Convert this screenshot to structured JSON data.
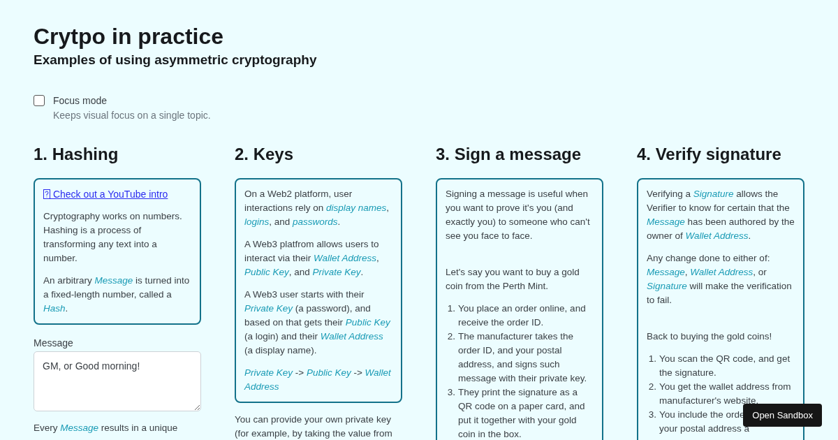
{
  "header": {
    "title": "Crytpo in practice",
    "subtitle": "Examples of using asymmetric cryptography"
  },
  "focus_mode": {
    "label": "Focus mode",
    "description": "Keeps visual focus on a single topic.",
    "checked": false
  },
  "sections": [
    {
      "heading": "1. Hashing",
      "card": [
        {
          "kind": "link",
          "text": "Check out a YouTube intro"
        },
        {
          "kind": "paragraph",
          "text": "Cryptography works on numbers. Hashing is a process of transforming any text into a number."
        },
        {
          "kind": "paragraph",
          "text": "An arbitrary *Message* is turned into a fixed-length number, called a *Hash*."
        }
      ],
      "after": [
        {
          "kind": "field",
          "label": "Message",
          "value": "GM, or Good morning!"
        },
        {
          "kind": "paragraph",
          "text": "Every *Message* results in a unique"
        }
      ]
    },
    {
      "heading": "2. Keys",
      "card": [
        {
          "kind": "paragraph",
          "text": "On a Web2 platform, user interactions rely on *display names*, *logins*, and *passwords*."
        },
        {
          "kind": "paragraph",
          "text": "A Web3 platfrom allows users to interact via their *Wallet Address*, *Public Key*, and *Private Key*."
        },
        {
          "kind": "paragraph",
          "text": "A Web3 user starts with their *Private Key* (a password), and based on that gets their *Public Key* (a login) and their *Wallet Address* (a display name)."
        },
        {
          "kind": "paragraph",
          "text": "*Private Key* -> *Public Key* -> *Wallet Address*"
        }
      ],
      "after": [
        {
          "kind": "paragraph",
          "text": "You can provide your own private key (for example, by taking the value from"
        }
      ]
    },
    {
      "heading": "3. Sign a message",
      "card": [
        {
          "kind": "paragraph",
          "text": "Signing a message is useful when you want to prove it's you (and exactly you) to someone who can't see you face to face."
        },
        {
          "kind": "spacer"
        },
        {
          "kind": "paragraph",
          "text": "Let's say you want to buy a gold coin from the Perth Mint."
        },
        {
          "kind": "list",
          "items": [
            {
              "marker": "1.",
              "lines": [
                "You place an order online, and receive the order ID."
              ]
            },
            {
              "marker": "2.",
              "lines": [
                "The manufacturer takes the order ID, and your postal address, and signs such message with their private key."
              ]
            },
            {
              "marker": "3.",
              "lines": [
                "They print the signature as a QR code on a paper card, and put it together with your gold coin in the box."
              ]
            }
          ]
        }
      ]
    },
    {
      "heading": "4. Verify signature",
      "card": [
        {
          "kind": "paragraph",
          "text": "Verifying a *Signature* allows the Verifier to know for certain that the *Message* has been authored by the owner of *Wallet Address*."
        },
        {
          "kind": "paragraph",
          "text": "Any change done to either of: *Message*, *Wallet Address*, or *Signature* will make the verification to fail."
        },
        {
          "kind": "spacer"
        },
        {
          "kind": "paragraph",
          "text": "Back to buying the gold coins!"
        },
        {
          "kind": "list",
          "items": [
            {
              "marker": "1.",
              "lines": [
                "You scan the QR code, and get the signature."
              ]
            },
            {
              "marker": "2.",
              "lines": [
                "You get the wallet address from manufacturer's website."
              ]
            },
            {
              "marker": "3.",
              "lines": [
                "You include the orde",
                "your postal address a"
              ]
            }
          ]
        }
      ]
    }
  ],
  "sandbox_button": "Open Sandbox"
}
